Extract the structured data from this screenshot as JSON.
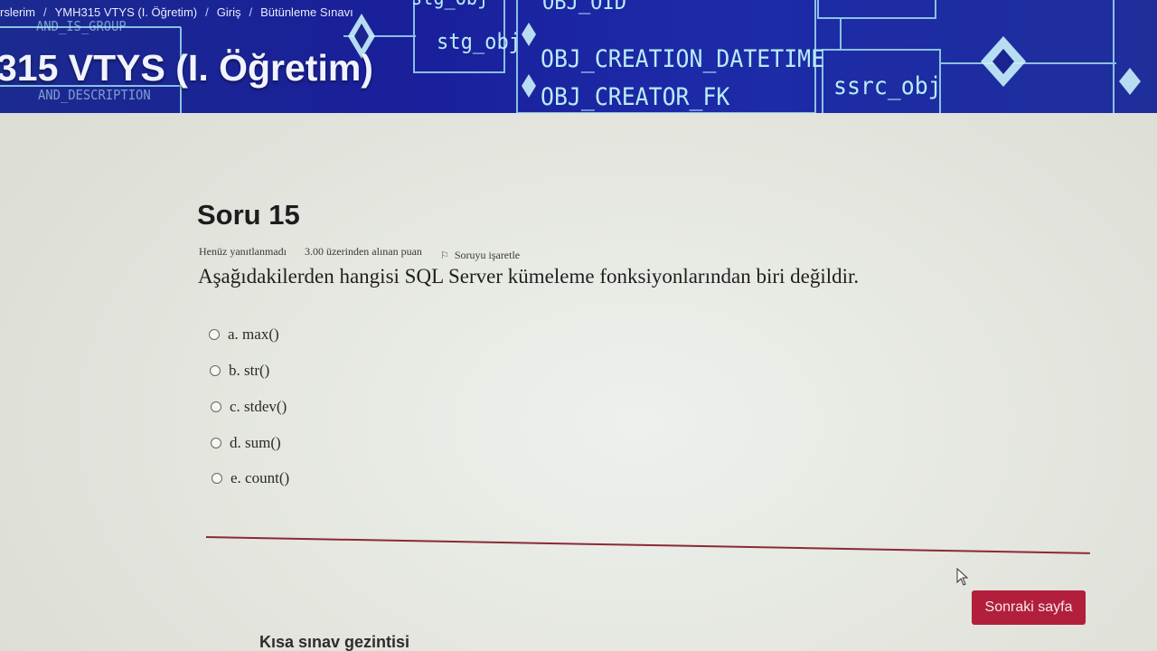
{
  "breadcrumb": {
    "items": [
      "rslerim",
      "YMH315 VTYS (I. Öğretim)",
      "Giriş",
      "Bütünleme Sınavı"
    ],
    "separator": "/"
  },
  "header": {
    "course_title": "315 VTYS (I. Öğretim)",
    "background_labels": [
      "AND_IS_GROUP",
      "AND_DESCRIPTION",
      "stg_obj",
      "OBJ_OID",
      "OBJ_CREATION_DATETIME",
      "OBJ_CREATOR_FK",
      "ssrc_obj"
    ]
  },
  "question": {
    "title": "Soru 15",
    "status": "Henüz yanıtlanmadı",
    "points": "3.00 üzerinden alınan puan",
    "flag_label": "Soruyu işaretle",
    "text": "Aşağıdakilerden hangisi SQL Server kümeleme fonksiyonlarından biri değildir.",
    "options": [
      {
        "label": "a. max()"
      },
      {
        "label": "b. str()"
      },
      {
        "label": "c. stdev()"
      },
      {
        "label": "d. sum()"
      },
      {
        "label": "e. count()"
      }
    ]
  },
  "actions": {
    "next_page": "Sonraki sayfa"
  },
  "navigation": {
    "heading": "Kısa sınav gezintisi"
  },
  "colors": {
    "banner": "#1c27a0",
    "accent": "#b21f3d",
    "background": "#e4e6df"
  }
}
